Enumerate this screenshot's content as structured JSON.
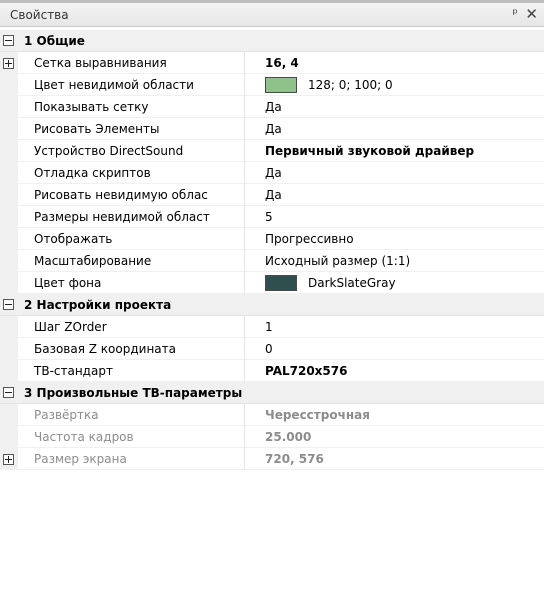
{
  "window": {
    "title": "Свойства",
    "pin_glyph": "ᵖ",
    "close_glyph": "✕"
  },
  "categories": [
    {
      "label": "1 Общие",
      "rows": [
        {
          "name": "Сетка выравнивания",
          "value": "16, 4"
        },
        {
          "name": "Цвет невидимой области",
          "value": "128; 0; 100; 0",
          "swatch": "#8fc28a"
        },
        {
          "name": "Показывать сетку",
          "value": "Да"
        },
        {
          "name": "Рисовать Элементы",
          "value": "Да"
        },
        {
          "name": "Устройство DirectSound",
          "value": "Первичный звуковой драйвер"
        },
        {
          "name": "Отладка скриптов",
          "value": "Да"
        },
        {
          "name": "Рисовать невидимую облас",
          "value": "Да"
        },
        {
          "name": "Размеры невидимой област",
          "value": "5"
        },
        {
          "name": "Отображать",
          "value": "Прогрессивно"
        },
        {
          "name": "Масштабирование",
          "value": "Исходный размер (1:1)"
        },
        {
          "name": "Цвет фона",
          "value": "DarkSlateGray",
          "swatch": "#2f4f4f"
        }
      ]
    },
    {
      "label": "2 Настройки проекта",
      "rows": [
        {
          "name": "Шаг ZOrder",
          "value": "1"
        },
        {
          "name": "Базовая Z координата",
          "value": "0"
        },
        {
          "name": "ТВ-стандарт",
          "value": "PAL720x576"
        }
      ]
    },
    {
      "label": "3 Произвольные ТВ-параметры",
      "rows": [
        {
          "name": "Развёртка",
          "value": "Чересстрочная"
        },
        {
          "name": "Частота кадров",
          "value": "25.000"
        },
        {
          "name": "Размер экрана",
          "value": "720, 576"
        }
      ]
    }
  ]
}
